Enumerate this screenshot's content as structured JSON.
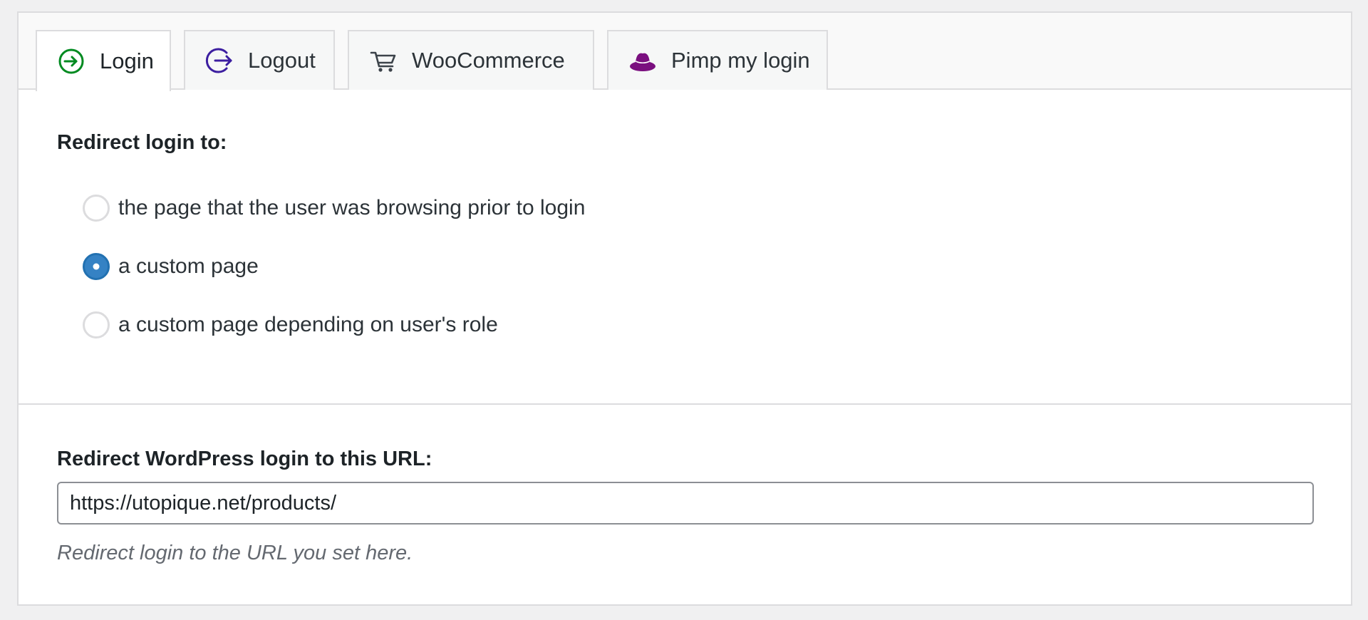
{
  "tabs": [
    {
      "label": "Login",
      "icon": "login-arrow-icon",
      "active": true,
      "icon_color": "#008a20"
    },
    {
      "label": "Logout",
      "icon": "logout-arrow-icon",
      "active": false,
      "icon_color": "#3c1ea0"
    },
    {
      "label": "WooCommerce",
      "icon": "cart-icon",
      "active": false,
      "icon_color": "#3c434a"
    },
    {
      "label": "Pimp my login",
      "icon": "hat-icon",
      "active": false,
      "icon_color": "#7a0f7f"
    }
  ],
  "redirect_section": {
    "title": "Redirect login to:",
    "options": [
      {
        "label": "the page that the user was browsing prior to login",
        "checked": false
      },
      {
        "label": "a custom page",
        "checked": true
      },
      {
        "label": "a custom page depending on user's role",
        "checked": false
      }
    ]
  },
  "url_section": {
    "title": "Redirect WordPress login to this URL:",
    "value": "https://utopique.net/products/",
    "help": "Redirect login to the URL you set here."
  },
  "colors": {
    "accent": "#2271b1",
    "radio_checked": "#3582c4"
  }
}
